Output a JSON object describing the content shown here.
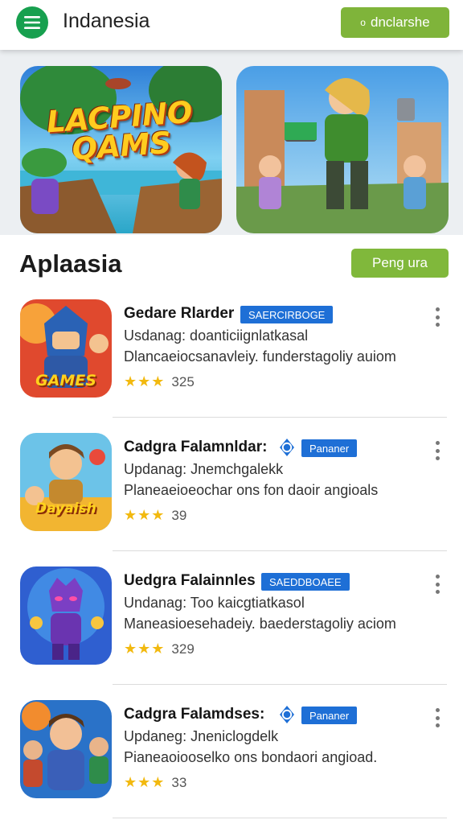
{
  "header": {
    "title": "Indanesia",
    "action_label": "dnclarshe",
    "action_icon": "circle-icon",
    "menu_icon": "menu-icon",
    "accent": "#17a04f"
  },
  "banners": [
    {
      "title": "LACPINO QAMS"
    },
    {
      "title": ""
    }
  ],
  "section": {
    "title": "Aplaasia",
    "button_label": "Peng ura"
  },
  "apps": [
    {
      "name": "Gedare Rlarder",
      "verified": false,
      "badge": "SAERCIRBOGE",
      "update": "Usdanag: doanticiignlatkasal",
      "description": "Dlancaeiocsanavleiy. funderstagoliy auiom",
      "stars": "★★★",
      "count": "325",
      "icon_text": "GAMES"
    },
    {
      "name": "Cadgra Falamnldar:",
      "verified": true,
      "badge": "Pananer",
      "update": "Updanag: Jnemchgalekk",
      "description": "Planeaeioeochar ons fon daoir angioals",
      "stars": "★★★",
      "count": "39",
      "icon_text": "Dayaish"
    },
    {
      "name": "Uedgra Falainnles",
      "verified": false,
      "badge": "SAEDDBOAEE",
      "update": "Undanag: Too kaicgtiatkasol",
      "description": "Maneasioesehadeiy. baederstagoliy aciom",
      "stars": "★★★",
      "count": "329",
      "icon_text": ""
    },
    {
      "name": "Cadgra Falamdses:",
      "verified": true,
      "badge": "Pananer",
      "update": "Updaneg: Jneniclogdelk",
      "description": "Pianeaoiooselko ons bondaori angioad.",
      "stars": "★★★",
      "count": "33",
      "icon_text": ""
    }
  ],
  "colors": {
    "button_green": "#80b83b",
    "badge_blue": "#1e6fd6",
    "star_yellow": "#f2b90f"
  }
}
